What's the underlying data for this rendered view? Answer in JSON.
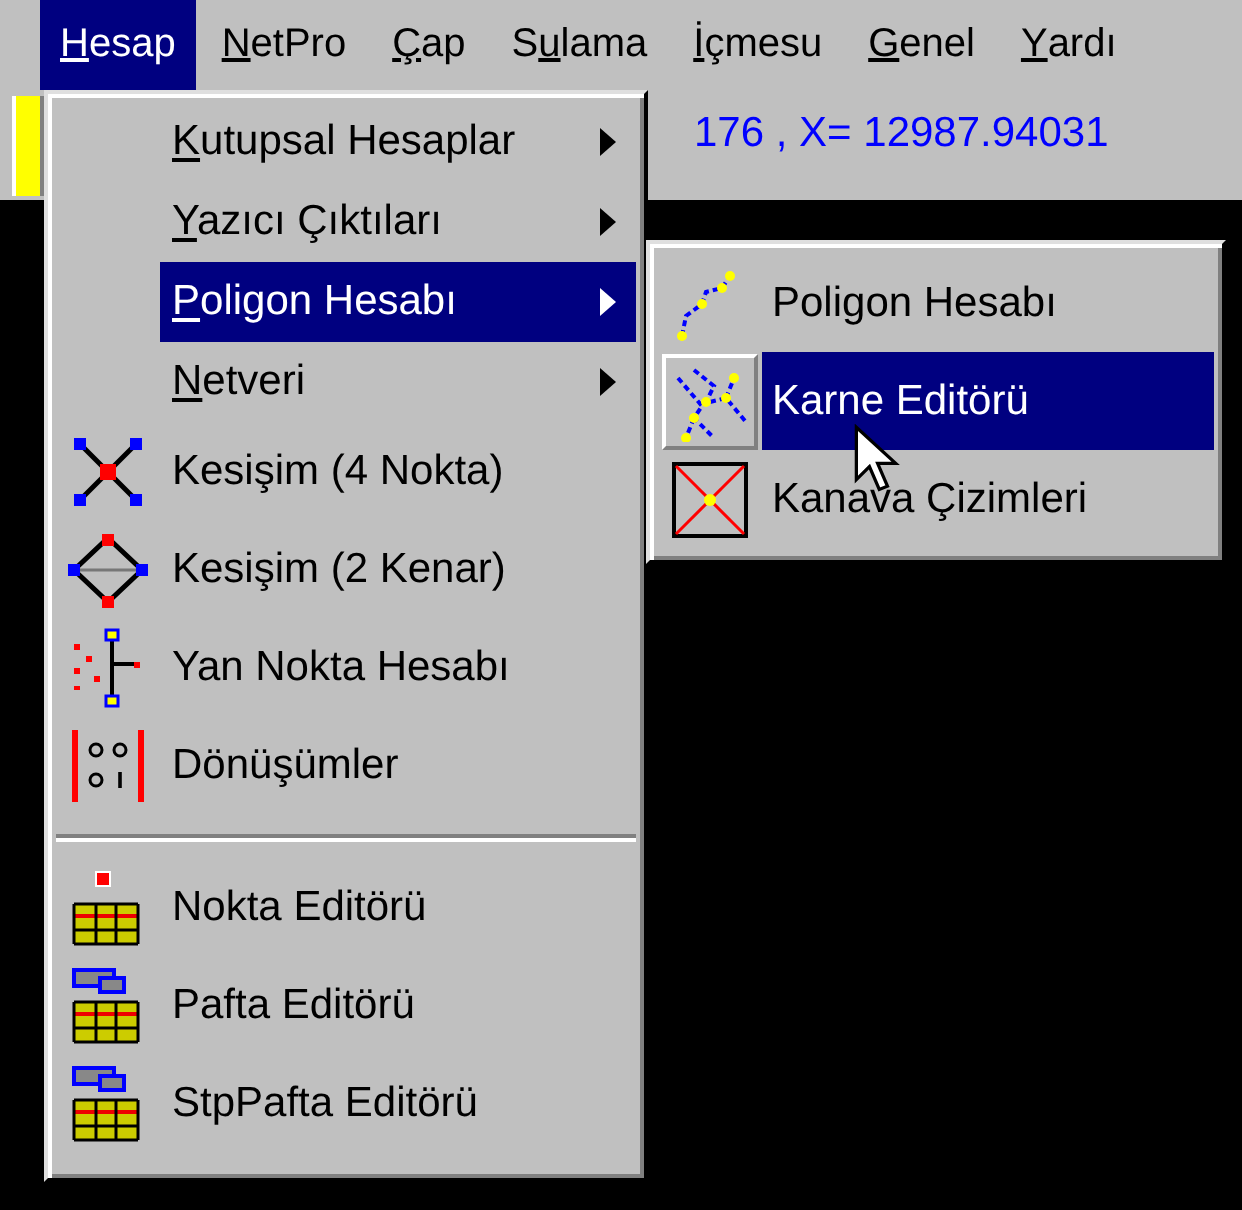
{
  "menu_bar": [
    {
      "key": "H",
      "post": "esap",
      "selected": true
    },
    {
      "key": "N",
      "post": "etPro",
      "selected": false
    },
    {
      "key": "Ç",
      "post": "ap",
      "selected": false
    },
    {
      "pre": "S",
      "key": "u",
      "post": "lama",
      "selected": false
    },
    {
      "key": "İ",
      "post": "çmesu",
      "selected": false
    },
    {
      "key": "G",
      "post": "enel",
      "selected": false
    },
    {
      "key": "Y",
      "post": "ardı",
      "selected": false
    }
  ],
  "coordinates": "176 , X= 12987.94031",
  "menu": [
    {
      "kind": "submenu",
      "key": "K",
      "post": "utupsal Hesaplar",
      "selected": false
    },
    {
      "kind": "submenu",
      "key": "Y",
      "post": "azıcı Çıktıları",
      "selected": false
    },
    {
      "kind": "submenu",
      "key": "P",
      "post": "oligon Hesabı",
      "selected": true
    },
    {
      "kind": "submenu",
      "key": "N",
      "post": "etveri",
      "selected": false
    },
    {
      "kind": "command",
      "pre": "Kesişim (4 Nokta)",
      "selected": false
    },
    {
      "kind": "command",
      "pre": "Kesişim (2 Kenar)",
      "selected": false
    },
    {
      "kind": "command",
      "pre": "Yan Nokta Hesabı",
      "selected": false
    },
    {
      "kind": "command",
      "pre": "Dönüşümler",
      "selected": false
    },
    {
      "kind": "separator"
    },
    {
      "kind": "command",
      "pre": "Nokta Editörü",
      "selected": false
    },
    {
      "kind": "command",
      "pre": "Pafta Editörü",
      "selected": false
    },
    {
      "kind": "command",
      "pre": "StpPafta Editörü",
      "selected": false
    }
  ],
  "submenu": [
    {
      "pre": "Poligon Hesabı",
      "selected": false
    },
    {
      "pre": "Karne Editörü",
      "selected": true
    },
    {
      "pre": "Kanava Çizimleri",
      "selected": false
    }
  ]
}
